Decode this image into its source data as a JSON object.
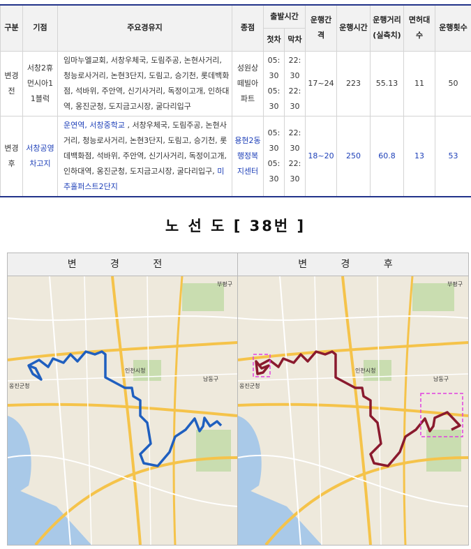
{
  "table": {
    "headers": {
      "category": "구분",
      "origin": "기점",
      "main_stops": "주요경유지",
      "terminus": "종점",
      "departure": "출발시간",
      "first": "첫차",
      "last": "막차",
      "interval": "운행간격",
      "run_time": "운행시간",
      "distance": "운행거리(실측치)",
      "vehicles": "면허대수",
      "trips": "운행횟수"
    },
    "before": {
      "category": "변경전",
      "origin": "서창2휴먼시아11블럭",
      "stops": "임마누엘교회, 서창우체국, 도림주공, 논현사거리, 청능로사거리, 논현3단지, 도림고, 승기천, 롯데백화점, 석바위, 주안역, 신기사거리, 독정이고개, 인하대역, 옹진군청, 도지금고시장, 굴다리입구",
      "terminus": "성원상떼빌아파트",
      "first": "05:30",
      "first2": "05:30",
      "last": "22:30",
      "last2": "22:30",
      "interval": "17~24",
      "run_time": "223",
      "distance": "55.13",
      "vehicles": "11",
      "trips": "50"
    },
    "after": {
      "category": "변경후",
      "origin": "서창공영차고지",
      "stops_pre": "운연역, 서창중학교",
      "stops_mid": " , 서창우체국, 도림주공, 논현사거리, 청능로사거리, 논현3단지, 도림고, 승기천, 롯데백화점, 석바위, 주안역, 신기사거리, 독정이고개, 인하대역, 옹진군청, 도지금고시장, 굴다리입구, ",
      "stops_post": "미추홀퍼스트2단지",
      "terminus": "용현2동행정복지센터",
      "first": "05:30",
      "first2": "05:30",
      "last": "22:30",
      "last2": "22:30",
      "interval": "18~20",
      "run_time": "250",
      "distance": "60.8",
      "vehicles": "13",
      "trips": "53"
    }
  },
  "route_map": {
    "title": "노 선 도 [ 38번 ]",
    "before_label": "변 경 전",
    "after_label": "변 경 후",
    "map_labels": {
      "city_hall": "인천시청",
      "ongjin": "옹진군청",
      "bupyeong": "부평구",
      "namdong": "남동구"
    },
    "colors": {
      "before_route": "#1f5fbf",
      "after_route": "#8a1a2e",
      "highlight": "#e040e0",
      "map_bg": "#eee9dc",
      "road": "#f5c34a",
      "water": "#a9c9e8",
      "park": "#c9ddb0"
    }
  }
}
